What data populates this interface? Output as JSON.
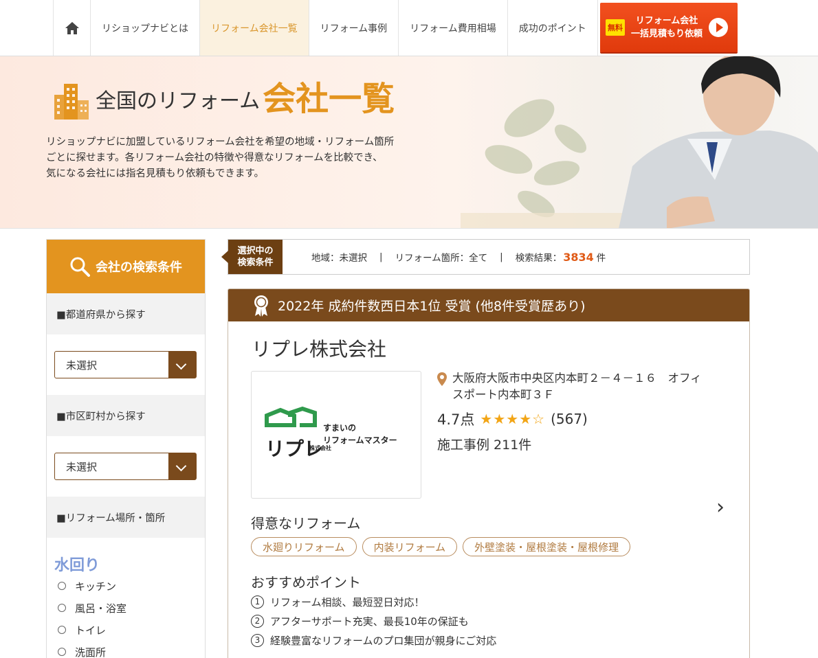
{
  "nav": {
    "items": [
      {
        "label": "リショップナビとは"
      },
      {
        "label": "リフォーム会社一覧"
      },
      {
        "label": "リフォーム事例"
      },
      {
        "label": "リフォーム費用相場"
      },
      {
        "label": "成功のポイント"
      }
    ],
    "cta": {
      "badge": "無料",
      "line1": "リフォーム会社",
      "line2": "一括見積もり依頼"
    }
  },
  "hero": {
    "title_small": "全国のリフォーム",
    "title_large": "会社一覧",
    "desc_line1": "リショップナビに加盟しているリフォーム会社を希望の地域・リフォーム箇所",
    "desc_line2": "ごとに探せます。各リフォーム会社の特徴や得意なリフォームを比較でき、",
    "desc_line3": "気になる会社には指名見積もり依頼もできます。"
  },
  "sidebar": {
    "header": "会社の検索条件",
    "prefecture_label": "■都道府県から探す",
    "prefecture_value": "未選択",
    "city_label": "■市区町村から探す",
    "city_value": "未選択",
    "place_label": "■リフォーム場所・箇所",
    "category": "水回り",
    "options": [
      "キッチン",
      "風呂・浴室",
      "トイレ",
      "洗面所"
    ]
  },
  "conditions": {
    "tag_line1": "選択中の",
    "tag_line2": "検索条件",
    "region": "地域：未選択",
    "sep": "|",
    "place": "リフォーム箇所：全て",
    "result_label": "検索結果：",
    "result_count": "3834",
    "result_unit": "件"
  },
  "card": {
    "award": "2022年 成約件数西日本1位 受賞 (他8件受賞歴あり)",
    "name": "リプレ株式会社",
    "logo": {
      "brand": "リプレ",
      "brand_sub": "株式会社",
      "tagline1": "すまいの",
      "tagline2": "リフォームマスター"
    },
    "address_line1": "大阪府大阪市中央区内本町２－４－１６　オフィ",
    "address_line2": "スポート内本町３Ｆ",
    "score": "4.7点",
    "stars_on": "★★★★",
    "stars_off": "☆",
    "review_count": "(567)",
    "cases": "施工事例 211件",
    "next": "›",
    "specialty_title": "得意なリフォーム",
    "specialties": [
      "水廻りリフォーム",
      "内装リフォーム",
      "外壁塗装・屋根塗装・屋根修理"
    ],
    "points_title": "おすすめポイント",
    "points": [
      {
        "num": "1",
        "text": "リフォーム相談、最短翌日対応！"
      },
      {
        "num": "2",
        "text": "アフターサポート充実、最長10年の保証も"
      },
      {
        "num": "3",
        "text": "経験豊富なリフォームのプロ集団が親身にご対応"
      }
    ]
  },
  "colors": {
    "accent": "#e3941f",
    "brown": "#7a4a1c",
    "cta": "#e8430f",
    "count": "#e05a16"
  }
}
